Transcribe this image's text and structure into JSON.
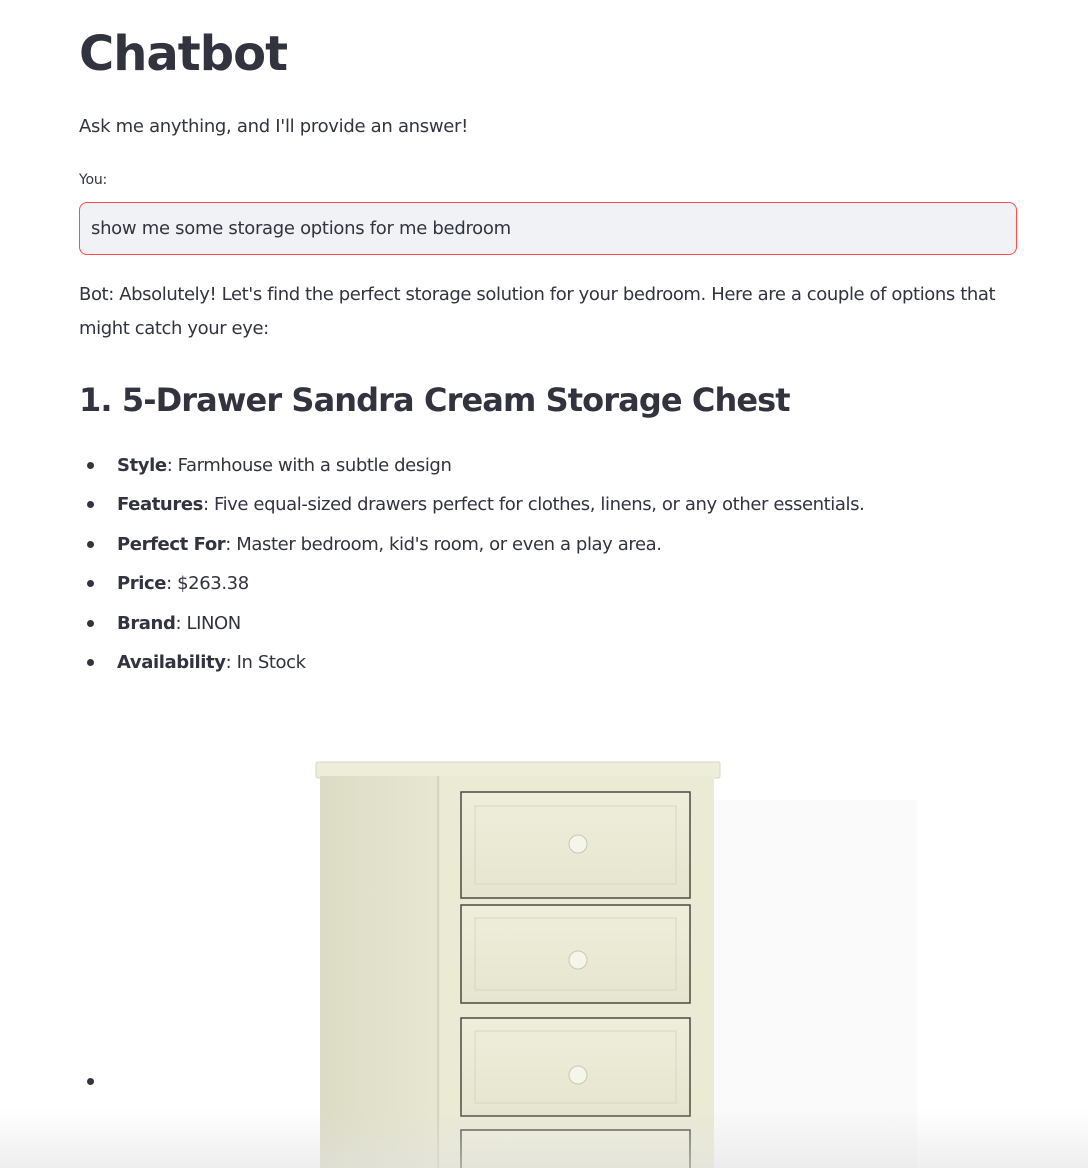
{
  "app": {
    "title": "Chatbot",
    "subtitle": "Ask me anything, and I'll provide an answer!"
  },
  "input": {
    "label": "You:",
    "value": "show me some storage options for me bedroom"
  },
  "response": {
    "intro": "Bot: Absolutely! Let's find the perfect storage solution for your bedroom. Here are a couple of options that might catch your eye:",
    "product": {
      "heading": "1. 5-Drawer Sandra Cream Storage Chest",
      "features": [
        {
          "key": "Style",
          "value": ": Farmhouse with a subtle design"
        },
        {
          "key": "Features",
          "value": ": Five equal-sized drawers perfect for clothes, linens, or any other essentials."
        },
        {
          "key": "Perfect For",
          "value": ": Master bedroom, kid's room, or even a play area."
        },
        {
          "key": "Price",
          "value": ": $263.38"
        },
        {
          "key": "Brand",
          "value": ": LINON"
        },
        {
          "key": "Availability",
          "value": ": In Stock"
        }
      ]
    }
  },
  "colors": {
    "text": "#31333f",
    "input_border": "#ff4b4b",
    "input_background": "#f0f2f6",
    "chest_body": "#ecebd6"
  }
}
